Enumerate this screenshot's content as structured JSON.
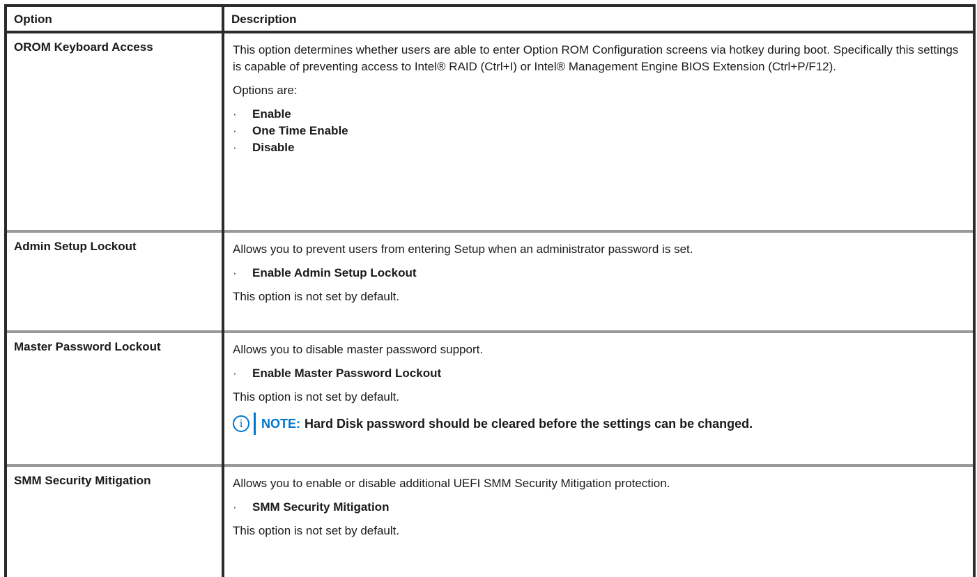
{
  "header": {
    "option": "Option",
    "description": "Description"
  },
  "rows": [
    {
      "option": "OROM Keyboard Access",
      "desc": "This option determines whether users are able to enter Option ROM Configuration screens via hotkey during boot. Specifically this settings is capable of preventing access to Intel® RAID (Ctrl+I) or Intel® Management Engine BIOS Extension (Ctrl+P/F12).",
      "options_label": "Options are:",
      "bullets": [
        "Enable",
        "One Time Enable",
        "Disable"
      ]
    },
    {
      "option": "Admin Setup Lockout",
      "desc": "Allows you to prevent users from entering Setup when an administrator password is set.",
      "bullets": [
        "Enable Admin Setup Lockout"
      ],
      "default_text": "This option is not set by default."
    },
    {
      "option": "Master Password Lockout",
      "desc": "Allows you to disable master password support.",
      "bullets": [
        "Enable Master Password Lockout"
      ],
      "default_text": "This option is not set by default.",
      "note": {
        "label": "NOTE:",
        "text": "Hard Disk password should be cleared before the settings can be changed.",
        "icon": "info-icon"
      }
    },
    {
      "option": "SMM Security Mitigation",
      "desc": "Allows you to enable or disable additional UEFI SMM Security Mitigation protection.",
      "bullets": [
        "SMM Security Mitigation"
      ],
      "default_text": "This option is not set by default."
    }
  ],
  "colors": {
    "border": "#2b2b2b",
    "row_separator": "#9a9a9a",
    "note_accent": "#0076ce"
  }
}
